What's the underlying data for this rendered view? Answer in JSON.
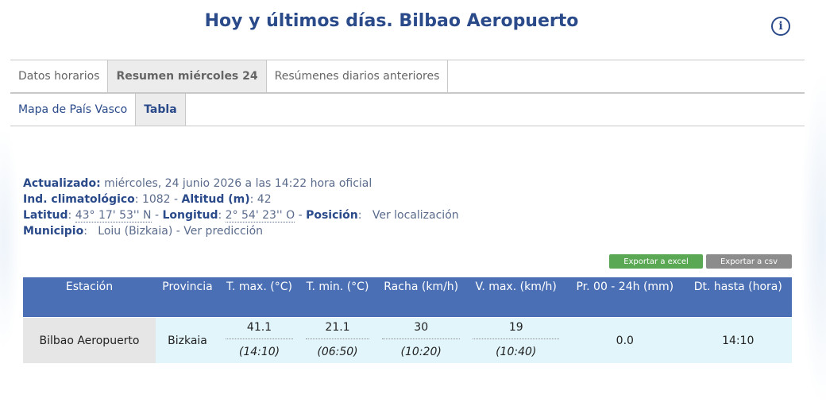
{
  "header": {
    "title": "Hoy y últimos días. Bilbao Aeropuerto",
    "info_icon": "info-icon"
  },
  "tabs_primary": [
    {
      "label": "Datos horarios",
      "active": false
    },
    {
      "label": "Resumen miércoles 24",
      "active": true
    },
    {
      "label": "Resúmenes diarios anteriores",
      "active": false
    }
  ],
  "tabs_secondary": [
    {
      "label": "Mapa de País Vasco",
      "active": false
    },
    {
      "label": "Tabla",
      "active": true
    }
  ],
  "meta": {
    "updated_label": "Actualizado:",
    "updated_value": " miércoles, 24 junio 2026 a las 14:22 hora oficial",
    "climat_label": "Ind. climatológico",
    "climat_value": ": 1082 - ",
    "altitude_label": "Altitud (m)",
    "altitude_value": ": 42",
    "lat_label": "Latitud",
    "lat_value": "43° 17' 53'' N",
    "lon_label": "Longitud",
    "lon_value": "2° 54' 23'' O",
    "position_label": "Posición",
    "position_link": "Ver localización",
    "municipio_label": "Municipio",
    "municipio_value": "Loiu (Bizkaia)",
    "prediction_link": "Ver predicción"
  },
  "export": {
    "excel_label": "Exportar a excel",
    "csv_label": "Exportar a csv"
  },
  "table": {
    "headers": [
      "Estación",
      "Provincia",
      "T. max. (°C)",
      "T. min. (°C)",
      "Racha (km/h)",
      "V. max. (km/h)",
      "Pr. 00 - 24h (mm)",
      "Dt. hasta (hora)"
    ],
    "row": {
      "station": "Bilbao Aeropuerto",
      "province": "Bizkaia",
      "tmax": "41.1",
      "tmax_time": "(14:10)",
      "tmin": "21.1",
      "tmin_time": "(06:50)",
      "gust": "30",
      "gust_time": "(10:20)",
      "vmax": "19",
      "vmax_time": "(10:40)",
      "precip": "0.0",
      "until": "14:10"
    }
  }
}
